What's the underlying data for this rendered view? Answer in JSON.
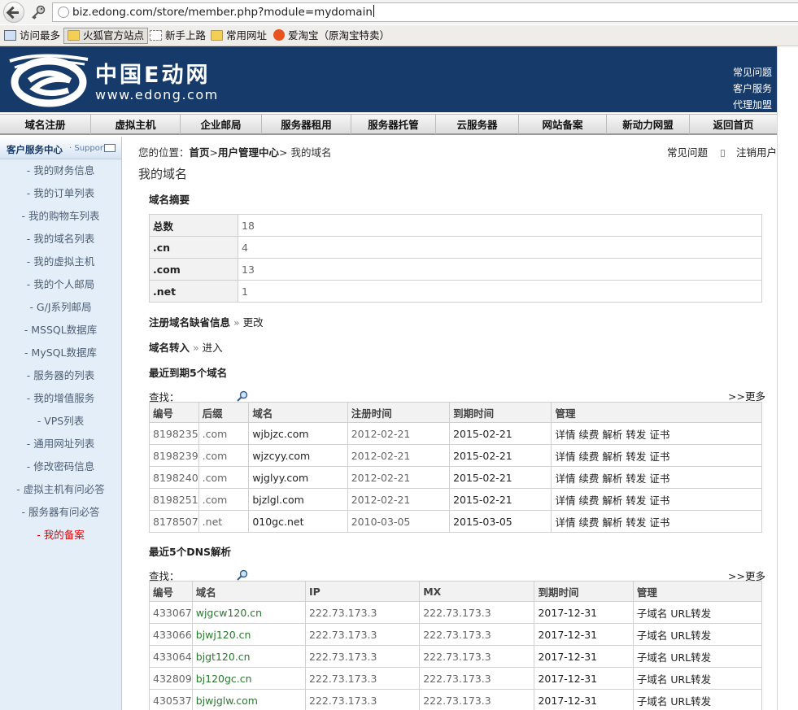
{
  "browser": {
    "url": "biz.edong.com/store/member.php?module=mydomain",
    "bookmarks": [
      "访问最多",
      "火狐官方站点",
      "新手上路",
      "常用网址",
      "爱淘宝（原淘宝特卖）"
    ]
  },
  "header": {
    "logo_cn": "中国E动网",
    "logo_en": "www.edong.com",
    "links": [
      "常见问题",
      "客户服务",
      "代理加盟"
    ]
  },
  "nav": [
    "域名注册",
    "虚拟主机",
    "企业邮局",
    "服务器租用",
    "服务器托管",
    "云服务器",
    "网站备案",
    "新动力网盟",
    "返回首页"
  ],
  "sidebar": {
    "title": "客户服务中心",
    "subtitle": "· Support",
    "items": [
      "- 我的财务信息",
      "- 我的订单列表",
      "- 我的购物车列表",
      "- 我的域名列表",
      "- 我的虚拟主机",
      "- 我的个人邮局",
      "- G/J系列邮局",
      "- MSSQL数据库",
      "- MySQL数据库",
      "- 服务器的列表",
      "- 我的增值服务",
      "- VPS列表",
      "- 通用网址列表",
      "- 修改密码信息",
      "- 虚拟主机有问必答",
      "- 服务器有问必答",
      "- 我的备案"
    ],
    "active_index": 16
  },
  "breadcrumb": {
    "prefix": "您的位置：",
    "home": "首页",
    "center": "用户管理中心",
    "current": "我的域名"
  },
  "util_links": [
    "常见问题",
    "注销用户"
  ],
  "page_title": "我的域名",
  "summary": {
    "title": "域名摘要",
    "rows": [
      [
        "总数",
        "18"
      ],
      [
        ".cn",
        "4"
      ],
      [
        ".com",
        "13"
      ],
      [
        ".net",
        "1"
      ]
    ]
  },
  "register_link": {
    "label": "注册域名缺省信息",
    "arrow": "»",
    "action": "更改"
  },
  "transfer_link": {
    "label": "域名转入",
    "arrow": "»",
    "action": "进入"
  },
  "expiring": {
    "title": "最近到期5个域名",
    "search_label": "查找：",
    "more": ">>更多",
    "headers": [
      "编号",
      "后缀",
      "域名",
      "注册时间",
      "到期时间",
      "管理"
    ],
    "rows": [
      [
        "8198235",
        ".com",
        "wjbjzc.com",
        "2012-02-21",
        "2015-02-21",
        "详情 续费 解析 转发  证书"
      ],
      [
        "8198239",
        ".com",
        "wjzcyy.com",
        "2012-02-21",
        "2015-02-21",
        "详情 续费 解析 转发  证书"
      ],
      [
        "8198240",
        ".com",
        "wjglyy.com",
        "2012-02-21",
        "2015-02-21",
        "详情 续费 解析 转发  证书"
      ],
      [
        "8198251",
        ".com",
        "bjzlgl.com",
        "2012-02-21",
        "2015-02-21",
        "详情 续费 解析 转发  证书"
      ],
      [
        "8178507",
        ".net",
        "010gc.net",
        "2010-03-05",
        "2015-03-05",
        "详情 续费 解析 转发  证书"
      ]
    ]
  },
  "dns": {
    "title": "最近5个DNS解析",
    "search_label": "查找：",
    "more": ">>更多",
    "headers": [
      "编号",
      "域名",
      "IP",
      "MX",
      "到期时间",
      "管理"
    ],
    "rows": [
      [
        "433067",
        "wjgcw120.cn",
        "222.73.173.3",
        "222.73.173.3",
        "2017-12-31",
        "子域名 URL转发"
      ],
      [
        "433066",
        "bjwj120.cn",
        "222.73.173.3",
        "222.73.173.3",
        "2017-12-31",
        "子域名 URL转发"
      ],
      [
        "433064",
        "bjgt120.cn",
        "222.73.173.3",
        "222.73.173.3",
        "2017-12-31",
        "子域名 URL转发"
      ],
      [
        "432809",
        "bj120gc.cn",
        "222.73.173.3",
        "222.73.173.3",
        "2017-12-31",
        "子域名 URL转发"
      ],
      [
        "430537",
        "bjwjglw.com",
        "222.73.173.3",
        "222.73.173.3",
        "2017-12-31",
        "子域名 URL转发"
      ]
    ]
  },
  "colors": {
    "header_bg": "#163a6a",
    "sidebar_bg": "#e3eef9",
    "active_red": "#e60000",
    "dns_domain_green": "#27792c"
  }
}
